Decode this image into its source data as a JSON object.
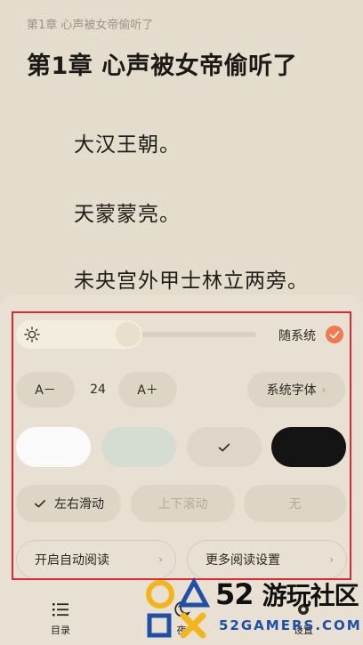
{
  "reader": {
    "chapter_small": "第1章 心声被女帝偷听了",
    "chapter_title": "第1章 心声被女帝偷听了",
    "paragraphs": [
      "大汉王朝。",
      "天蒙蒙亮。",
      "未央宫外甲士林立两旁。"
    ]
  },
  "settings": {
    "brightness": {
      "level_fraction": 0.5,
      "follow_system_label": "随系统",
      "follow_system_checked": true
    },
    "font": {
      "decrease_label": "A－",
      "size_value": "24",
      "increase_label": "A＋",
      "face_label": "系统字体"
    },
    "themes": [
      {
        "name": "white",
        "color": "#fbfafa"
      },
      {
        "name": "green",
        "color": "#d5dcd2"
      },
      {
        "name": "tan",
        "color": "#ded6c8",
        "selected": true
      },
      {
        "name": "black",
        "color": "#141414"
      }
    ],
    "page_modes": {
      "left_right": "左右滑动",
      "up_down": "上下滚动",
      "none": "无"
    },
    "auto_read_label": "开启自动阅读",
    "more_settings_label": "更多阅读设置"
  },
  "nav": {
    "catalog": "目录",
    "night": "夜",
    "settings": "设置"
  },
  "watermark": {
    "number": "52",
    "cn": "游玩社区",
    "en": "52GAMERS.COM"
  },
  "colors": {
    "accent": "#f07a4e",
    "highlight_frame": "#e0262f",
    "background": "#e4dccd"
  }
}
